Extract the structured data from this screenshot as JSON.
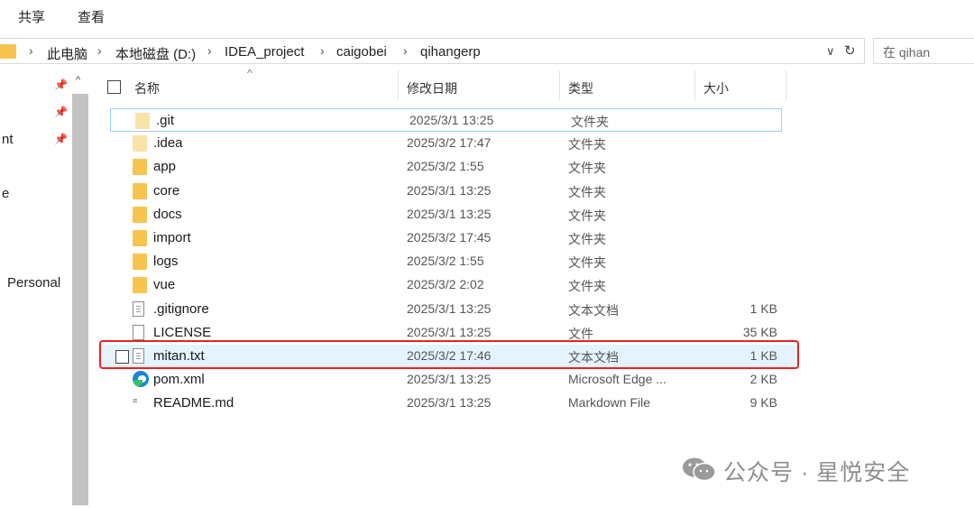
{
  "ribbon": {
    "tabs": [
      "共享",
      "查看"
    ]
  },
  "address": {
    "crumbs": [
      "此电脑",
      "本地磁盘 (D:)",
      "IDEA_project",
      "caigobei",
      "qihangerp"
    ],
    "separator": "›",
    "dropdown_glyph": "∨",
    "refresh_glyph": "↻"
  },
  "search": {
    "placeholder": "在 qihan"
  },
  "nav": {
    "items": [
      "nt",
      "e",
      "Personal"
    ],
    "pin_glyph": "📌",
    "up_glyph": "^"
  },
  "columns": {
    "name": "名称",
    "date": "修改日期",
    "type": "类型",
    "size": "大小",
    "sort_glyph": "^"
  },
  "files": [
    {
      "name": ".git",
      "date": "2025/3/1 13:25",
      "type": "文件夹",
      "size": "",
      "icon": "folder-icon"
    },
    {
      "name": ".idea",
      "date": "2025/3/2 17:47",
      "type": "文件夹",
      "size": "",
      "icon": "folder-icon"
    },
    {
      "name": "app",
      "date": "2025/3/2 1:55",
      "type": "文件夹",
      "size": "",
      "icon": "folder-icon"
    },
    {
      "name": "core",
      "date": "2025/3/1 13:25",
      "type": "文件夹",
      "size": "",
      "icon": "folder-icon"
    },
    {
      "name": "docs",
      "date": "2025/3/1 13:25",
      "type": "文件夹",
      "size": "",
      "icon": "folder-icon"
    },
    {
      "name": "import",
      "date": "2025/3/2 17:45",
      "type": "文件夹",
      "size": "",
      "icon": "folder-icon"
    },
    {
      "name": "logs",
      "date": "2025/3/2 1:55",
      "type": "文件夹",
      "size": "",
      "icon": "folder-icon"
    },
    {
      "name": "vue",
      "date": "2025/3/2 2:02",
      "type": "文件夹",
      "size": "",
      "icon": "folder-icon"
    },
    {
      "name": ".gitignore",
      "date": "2025/3/1 13:25",
      "type": "文本文档",
      "size": "1 KB",
      "icon": "text-file-icon"
    },
    {
      "name": "LICENSE",
      "date": "2025/3/1 13:25",
      "type": "文件",
      "size": "35 KB",
      "icon": "file-icon"
    },
    {
      "name": "mitan.txt",
      "date": "2025/3/2 17:46",
      "type": "文本文档",
      "size": "1 KB",
      "icon": "text-file-icon"
    },
    {
      "name": "pom.xml",
      "date": "2025/3/1 13:25",
      "type": "Microsoft Edge ...",
      "size": "2 KB",
      "icon": "edge-icon"
    },
    {
      "name": "README.md",
      "date": "2025/3/1 13:25",
      "type": "Markdown File",
      "size": "9 KB",
      "icon": "markdown-file-icon"
    }
  ],
  "highlighted_file": "mitan.txt",
  "watermark": {
    "text": "公众号 · 星悦安全"
  },
  "colors": {
    "folder": "#f7c54f",
    "highlight_border": "#e8231f",
    "selection": "#e5f3ff",
    "focus_border": "#99d1ff"
  }
}
